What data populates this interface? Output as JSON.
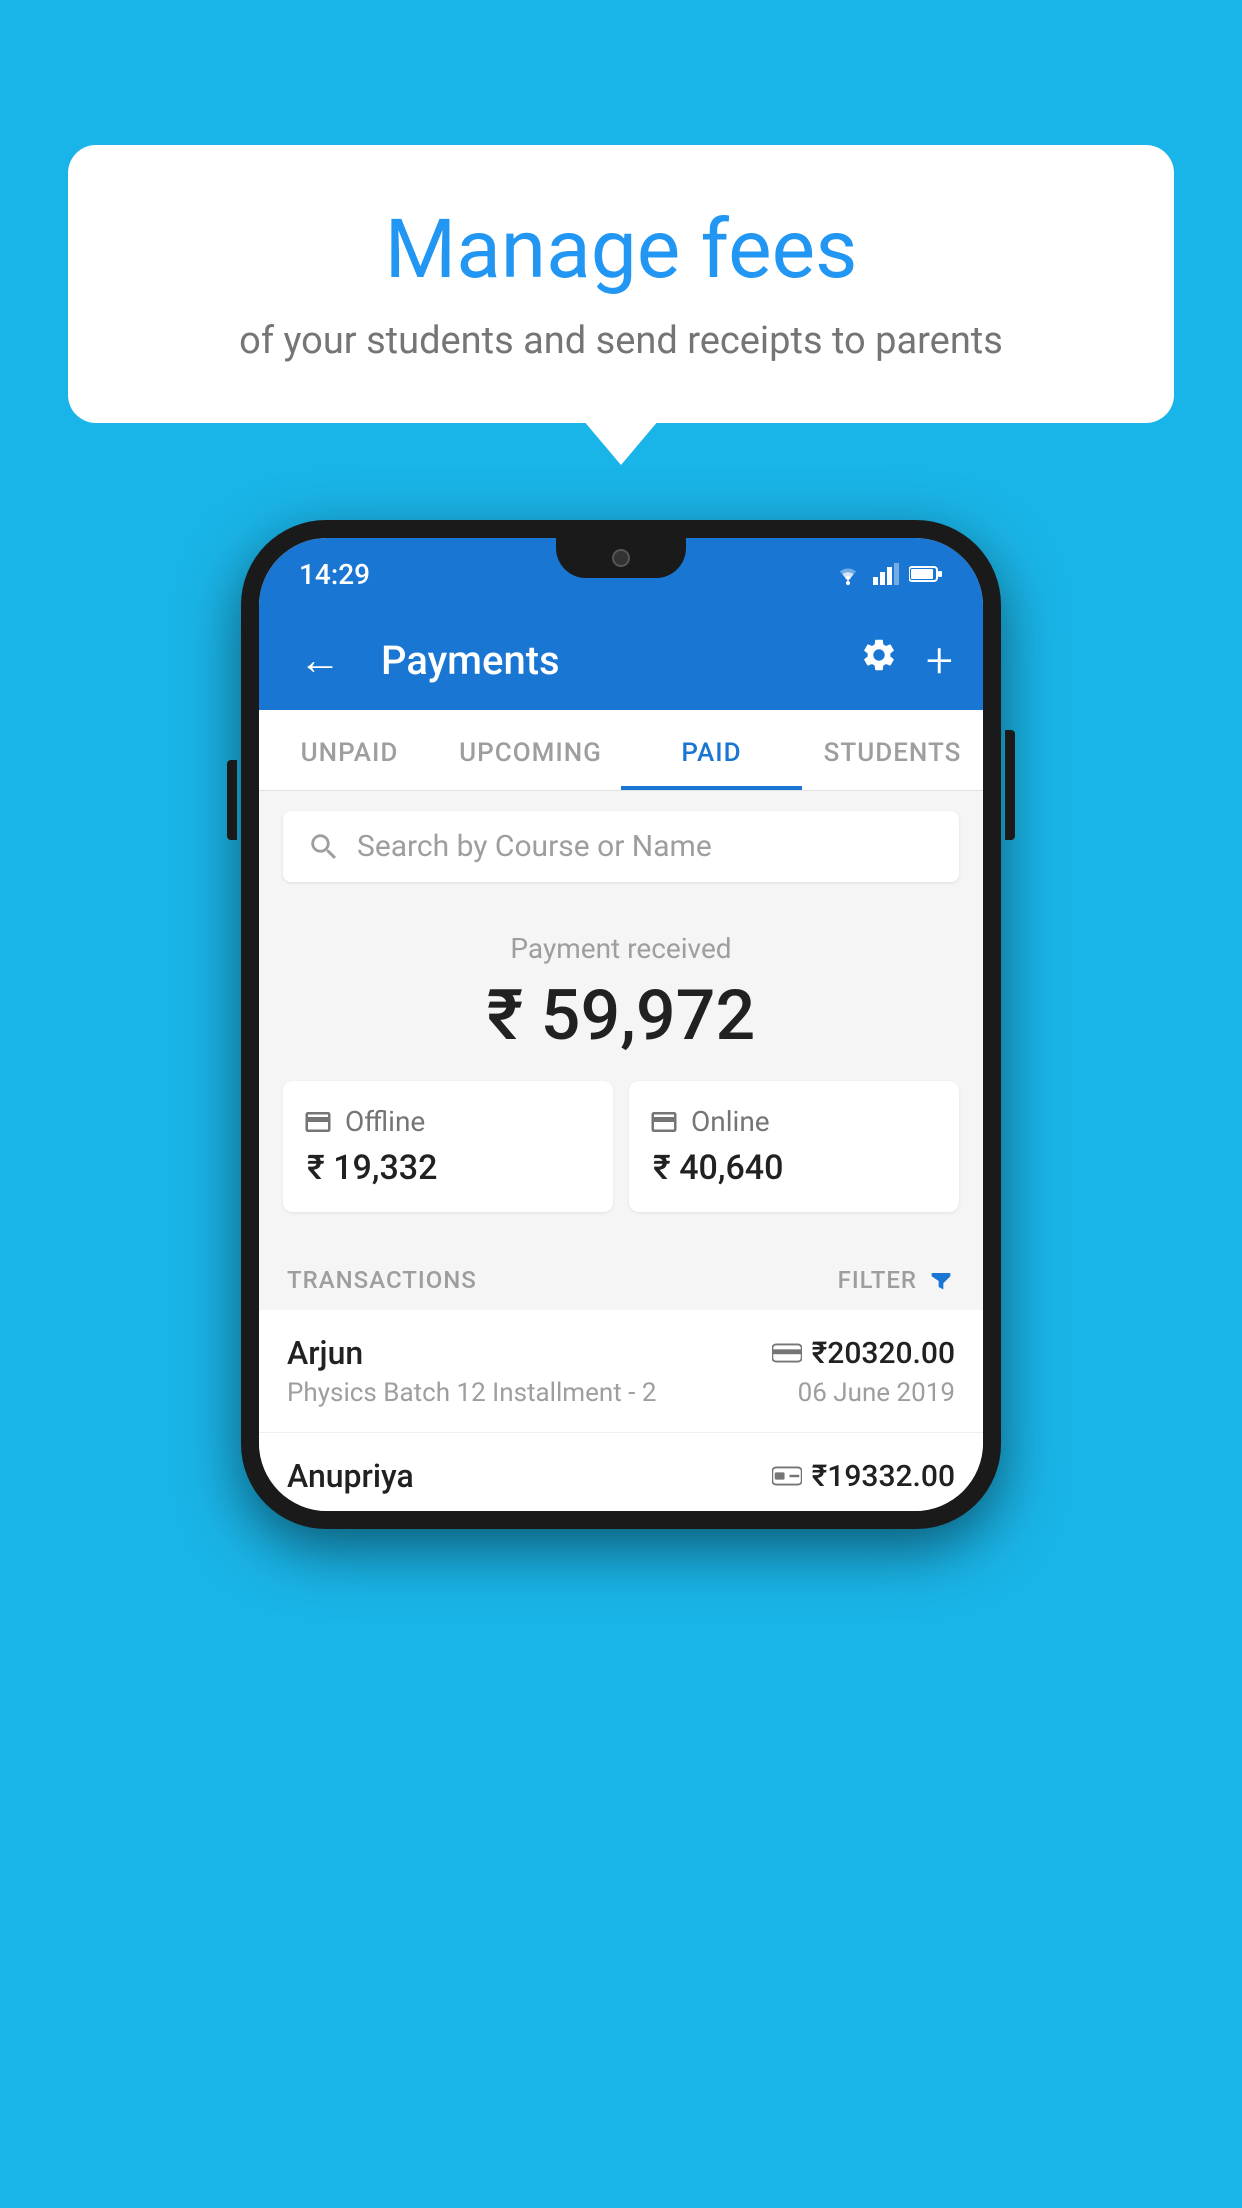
{
  "background_color": "#1ab5e8",
  "bubble": {
    "title": "Manage fees",
    "subtitle": "of your students and send receipts to parents"
  },
  "phone": {
    "status_bar": {
      "time": "14:29",
      "icons": [
        "wifi",
        "signal",
        "battery"
      ]
    },
    "toolbar": {
      "title": "Payments",
      "back_label": "←",
      "settings_label": "⚙",
      "add_label": "+"
    },
    "tabs": [
      {
        "label": "UNPAID",
        "active": false
      },
      {
        "label": "UPCOMING",
        "active": false
      },
      {
        "label": "PAID",
        "active": true
      },
      {
        "label": "STUDENTS",
        "active": false
      }
    ],
    "search": {
      "placeholder": "Search by Course or Name"
    },
    "payment_summary": {
      "label": "Payment received",
      "total": "₹ 59,972",
      "offline": {
        "type": "Offline",
        "amount": "₹ 19,332"
      },
      "online": {
        "type": "Online",
        "amount": "₹ 40,640"
      }
    },
    "transactions_section": {
      "label": "TRANSACTIONS",
      "filter_label": "FILTER"
    },
    "transactions": [
      {
        "name": "Arjun",
        "detail": "Physics Batch 12 Installment - 2",
        "amount": "₹20320.00",
        "date": "06 June 2019",
        "type": "online"
      },
      {
        "name": "Anupriya",
        "detail": "",
        "amount": "₹19332.00",
        "date": "",
        "type": "offline"
      }
    ]
  }
}
